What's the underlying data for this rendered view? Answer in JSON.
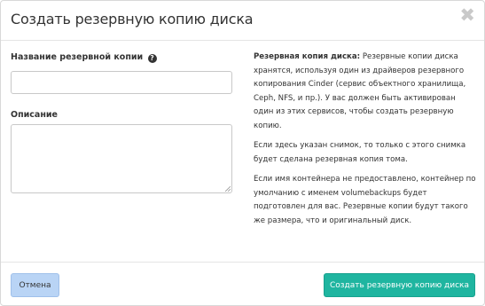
{
  "modal": {
    "title": "Создать резервную копию диска",
    "close_icon": "close-icon"
  },
  "form": {
    "name_label": "Название резервной копии",
    "name_help_icon": "question-circle-icon",
    "name_value": "",
    "description_label": "Описание",
    "description_value": ""
  },
  "help": {
    "intro_bold": "Резервная копия диска:",
    "intro_text": " Резервные копии диска хранятся, используя один из драйверов резервного копирования Cinder (сервис объектного хранилища, Ceph, NFS, и пр.). У вас должен быть активирован один из этих сервисов, чтобы создать резервную копию.",
    "snapshot_text": "Если здесь указан снимок, то только с этого снимка будет сделана резервная копия тома.",
    "container_text": "Если имя контейнера не предоставлено, контейнер по умолчанию с именем volumebackups будет подготовлен для вас. Резервные копии будут такого же размера, что и оригинальный диск."
  },
  "footer": {
    "cancel_label": "Отмена",
    "submit_label": "Создать резервную копию диска"
  },
  "colors": {
    "cancel_bg": "#b9d4f5",
    "submit_bg": "#1fb5a0"
  }
}
